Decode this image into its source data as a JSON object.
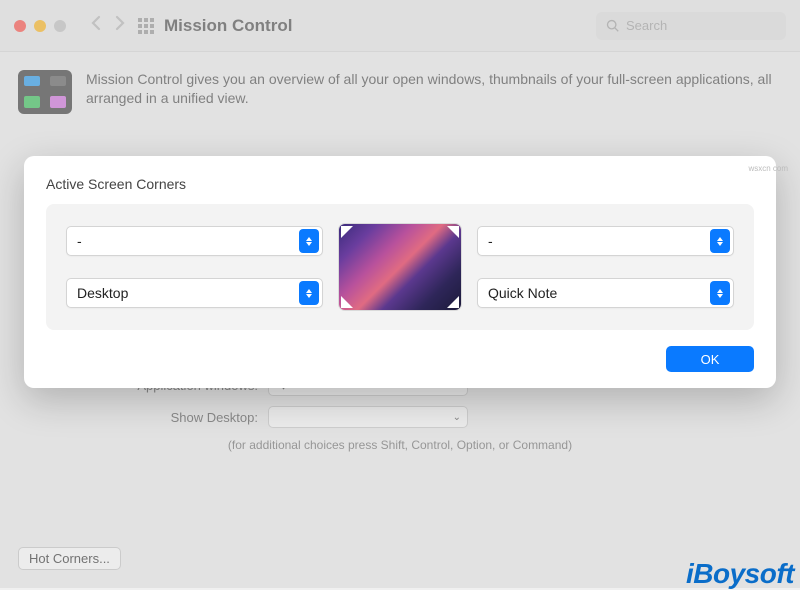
{
  "toolbar": {
    "title": "Mission Control",
    "search_placeholder": "Search"
  },
  "description": "Mission Control gives you an overview of all your open windows, thumbnails of your full-screen applications, all arranged in a unified view.",
  "background": {
    "row1_label": "Application windows:",
    "row1_value": "^↓",
    "row2_label": "Show Desktop:",
    "row2_value": "",
    "hint": "(for additional choices press Shift, Control, Option, or Command)",
    "hot_corners_button": "Hot Corners..."
  },
  "modal": {
    "title": "Active Screen Corners",
    "corners": {
      "top_left": "-",
      "top_right": "-",
      "bottom_left": "Desktop",
      "bottom_right": "Quick Note"
    },
    "ok_button": "OK"
  },
  "watermark": "iBoysoft",
  "toptag": "wsxcn com"
}
